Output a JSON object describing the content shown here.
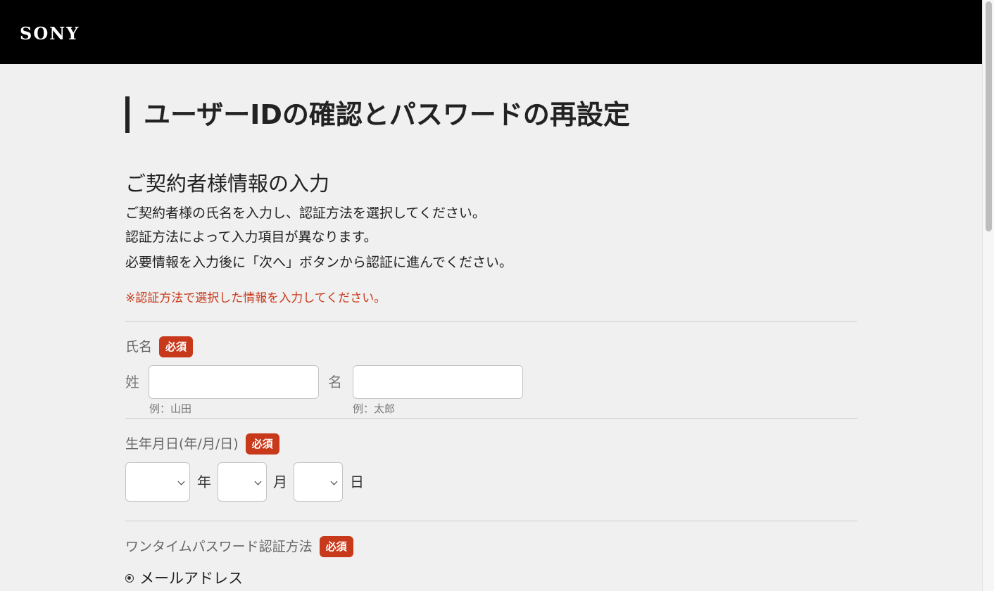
{
  "header": {
    "logo": "SONY"
  },
  "page": {
    "title": "ユーザーIDの確認とパスワードの再設定",
    "section_title": "ご契約者様情報の入力",
    "description": [
      "ご契約者様の氏名を入力し、認証方法を選択してください。",
      "認証方法によって入力項目が異なります。",
      "必要情報を入力後に「次へ」ボタンから認証に進んでください。"
    ],
    "notice": "※認証方法で選択した情報を入力してください。"
  },
  "form": {
    "required_badge": "必須",
    "name": {
      "label": "氏名",
      "last_name_label": "姓",
      "first_name_label": "名",
      "last_name_value": "",
      "first_name_value": "",
      "last_name_example": "例：山田",
      "first_name_example": "例：太郎"
    },
    "birthdate": {
      "label": "生年月日(年/月/日)",
      "year_value": "",
      "month_value": "",
      "day_value": "",
      "year_unit": "年",
      "month_unit": "月",
      "day_unit": "日"
    },
    "otp_method": {
      "label": "ワンタイムパスワード認証方法",
      "options": [
        {
          "label": "メールアドレス",
          "selected": true
        }
      ]
    }
  }
}
